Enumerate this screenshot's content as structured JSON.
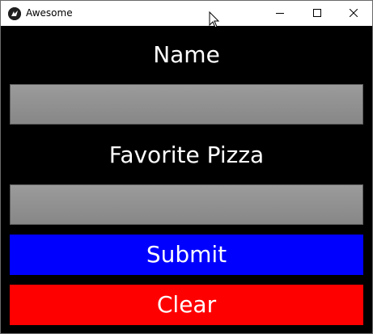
{
  "window": {
    "title": "Awesome",
    "icons": {
      "app": "kivy-app-icon",
      "minimize": "minimize-icon",
      "maximize": "maximize-icon",
      "close": "close-icon"
    }
  },
  "form": {
    "name_label": "Name",
    "name_value": "",
    "pizza_label": "Favorite Pizza",
    "pizza_value": "",
    "submit_label": "Submit",
    "clear_label": "Clear"
  },
  "colors": {
    "background": "#000000",
    "submit": "#0000ff",
    "clear": "#ff0000",
    "input": "#8c8c8c"
  }
}
